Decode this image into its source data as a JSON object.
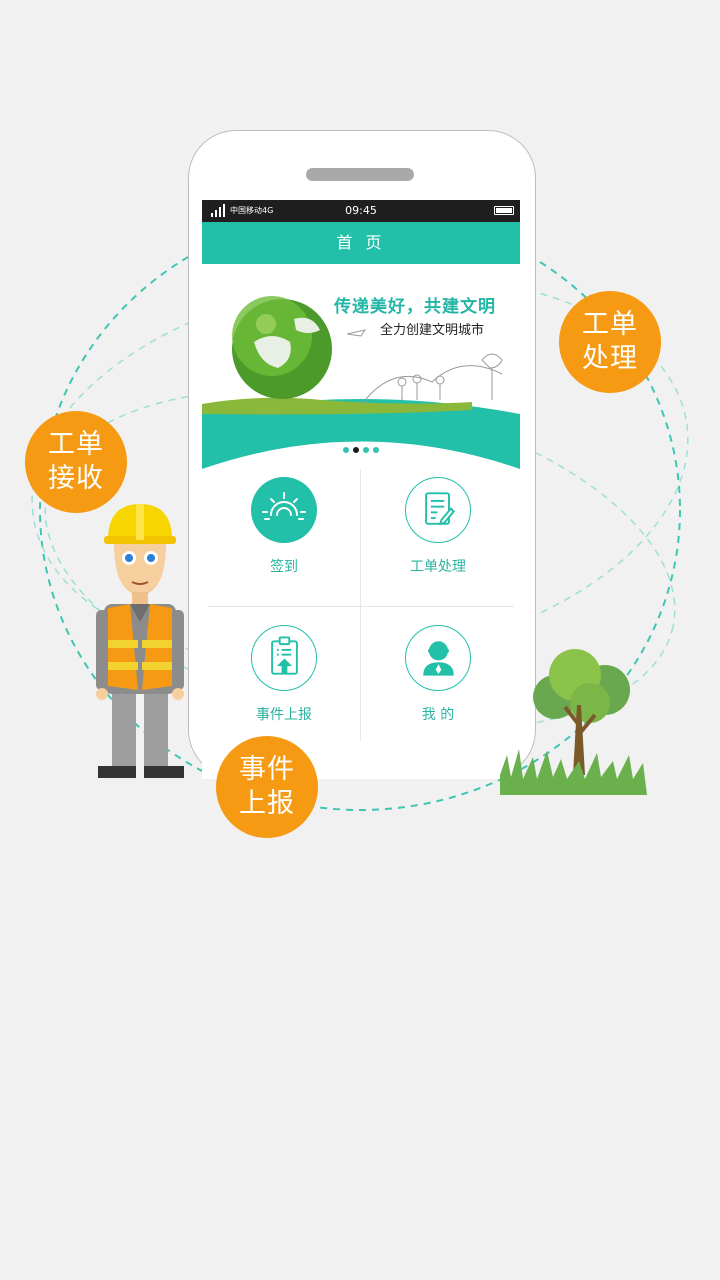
{
  "bubbles": {
    "receive": [
      "工单",
      "接收"
    ],
    "process": [
      "工单",
      "处理"
    ],
    "report": [
      "事件",
      "上报"
    ]
  },
  "statusbar": {
    "carrier": "中国移动4G",
    "network": "4G",
    "time": "09:45"
  },
  "header": {
    "title": "首 页"
  },
  "banner": {
    "headline": "传递美好，共建文明",
    "subline": "全力创建文明城市",
    "active_slide": 2,
    "slide_count": 4
  },
  "menu": [
    {
      "label": "签到",
      "icon": "sun-icon"
    },
    {
      "label": "工单处理",
      "icon": "edit-document-icon"
    },
    {
      "label": "事件上报",
      "icon": "clipboard-upload-icon"
    },
    {
      "label": "我 的",
      "icon": "user-icon"
    }
  ],
  "colors": {
    "accent": "#22bfa9",
    "bubble": "#f59a12",
    "background": "#f1f1f1"
  }
}
